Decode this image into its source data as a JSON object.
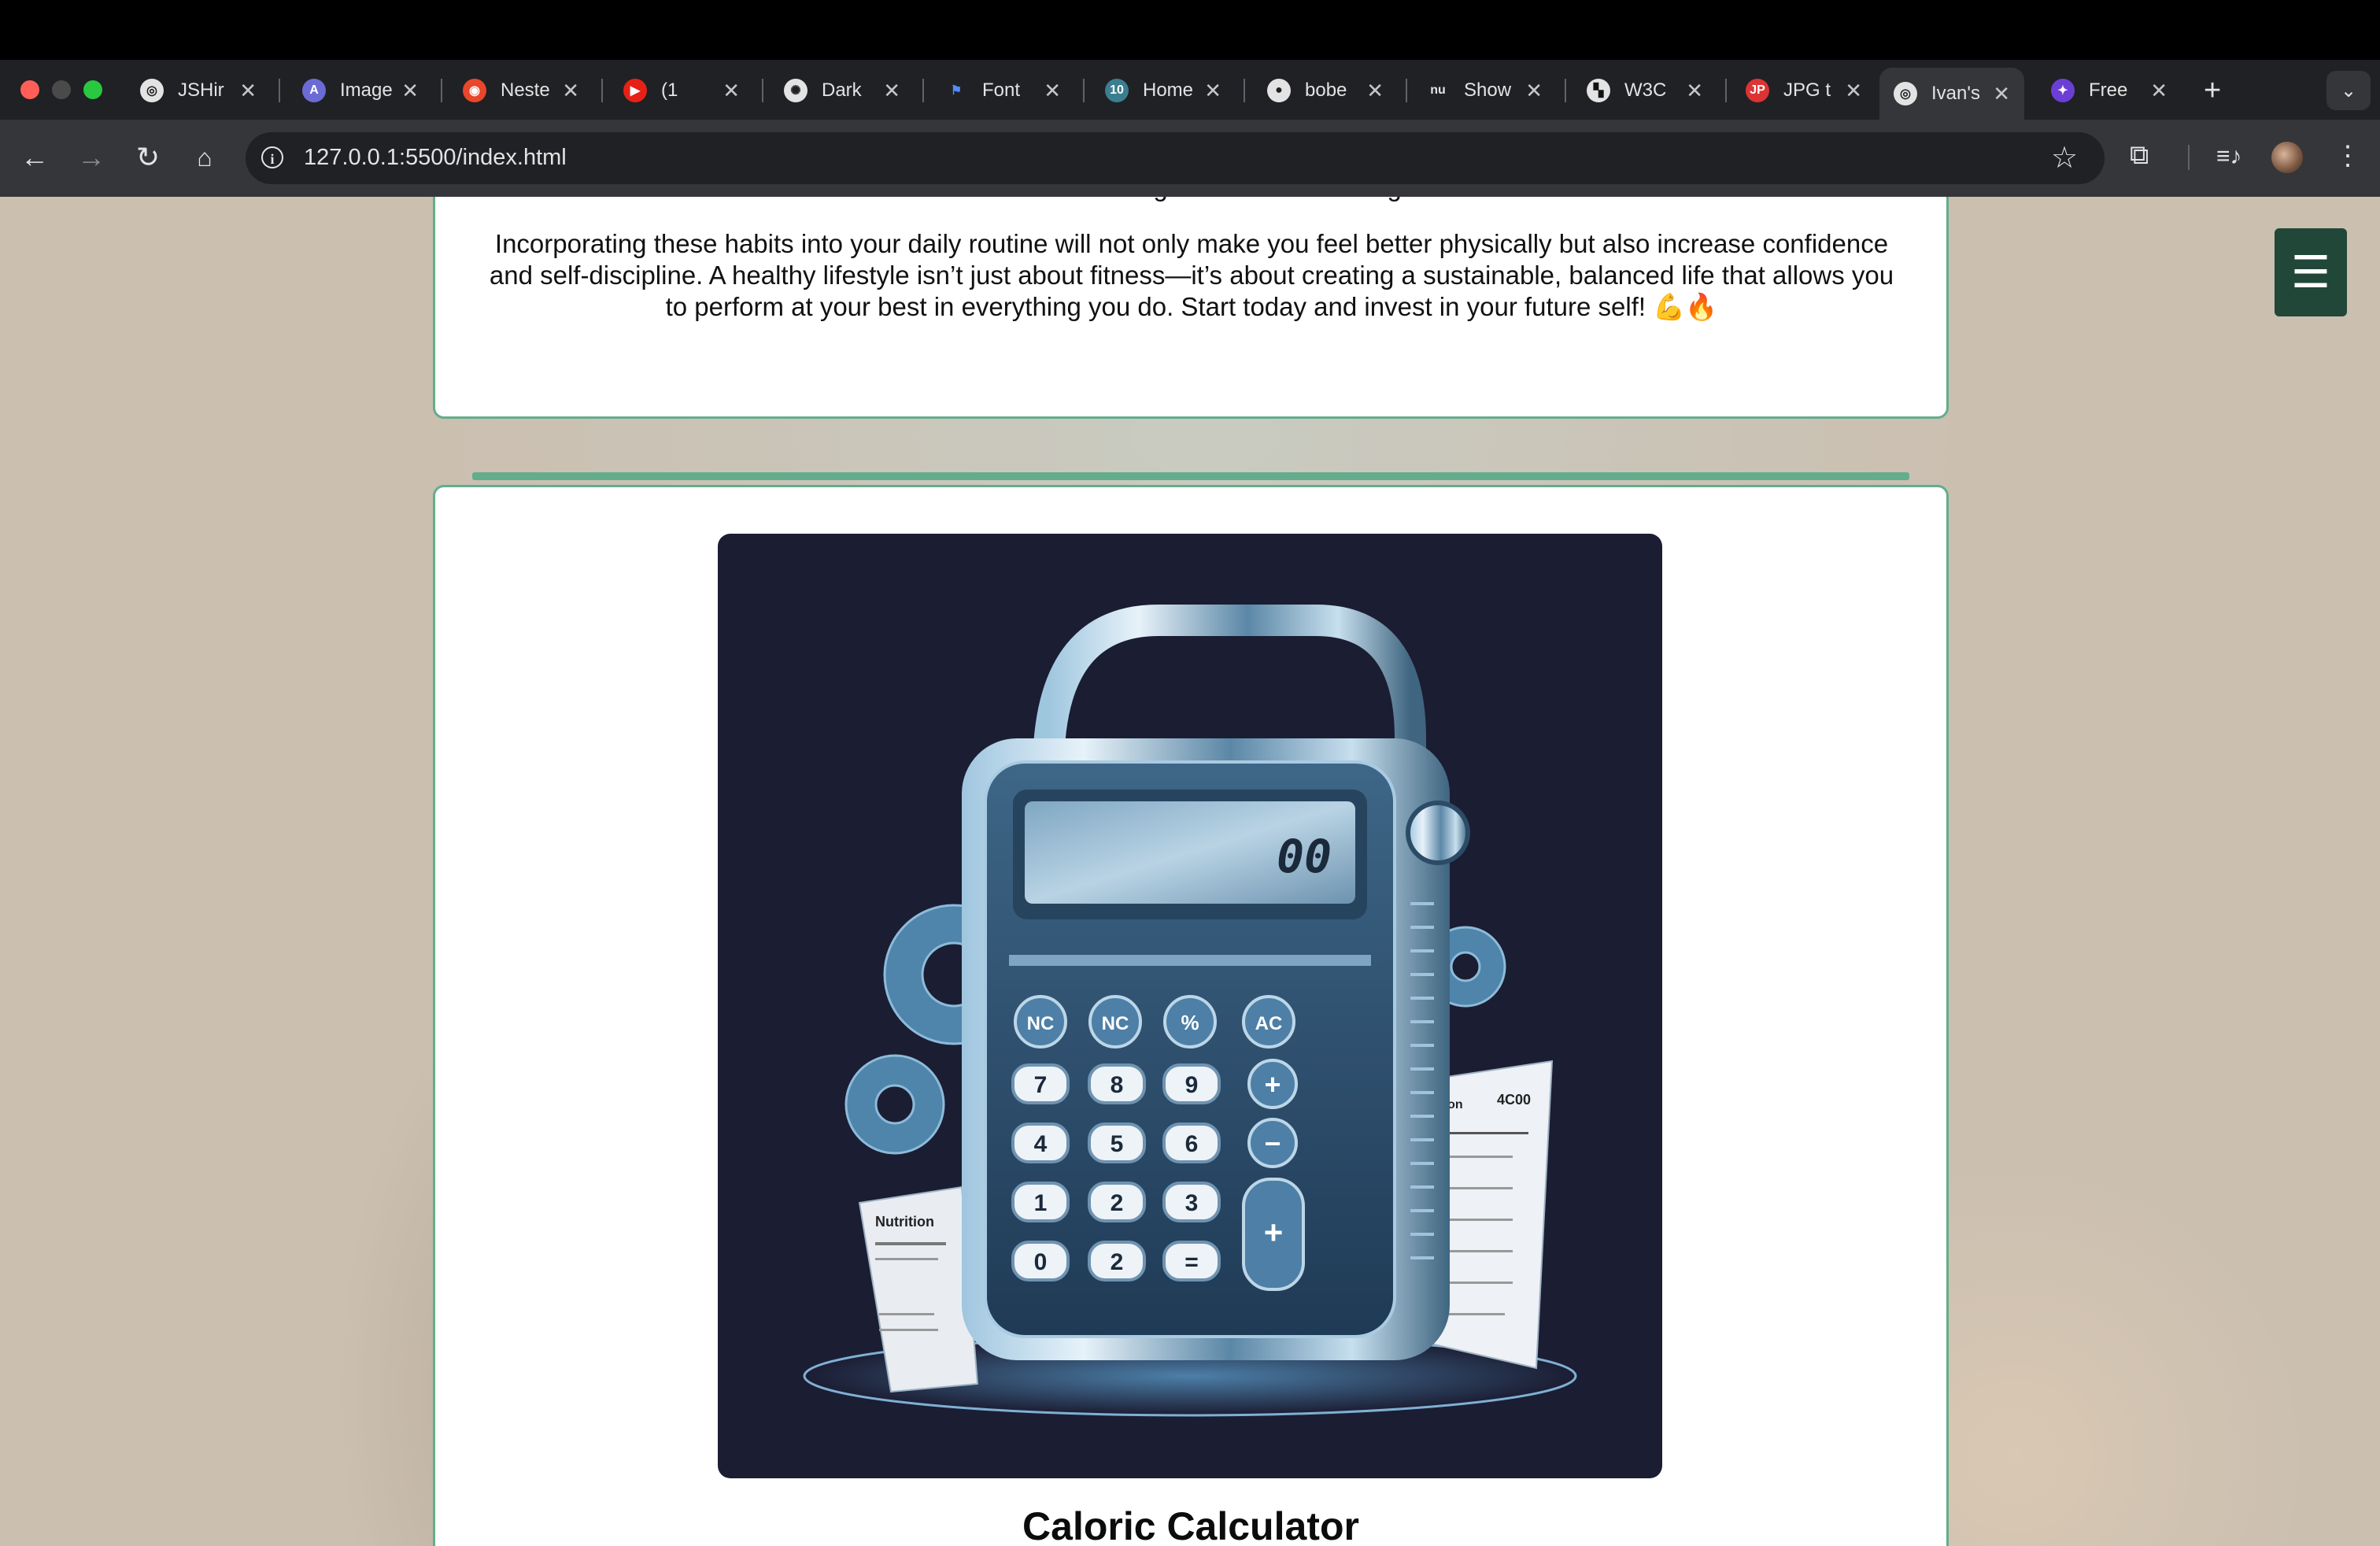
{
  "browser": {
    "tabs": [
      {
        "title": "JSHir",
        "icon": "globe-icon"
      },
      {
        "title": "Image",
        "icon": "ai-image-icon"
      },
      {
        "title": "Neste",
        "icon": "target-icon"
      },
      {
        "title": "(1",
        "icon": "youtube-icon"
      },
      {
        "title": "Dark",
        "icon": "openai-icon"
      },
      {
        "title": "Font",
        "icon": "flag-icon"
      },
      {
        "title": "Home",
        "icon": "w3schools-icon"
      },
      {
        "title": "bobe",
        "icon": "github-icon"
      },
      {
        "title": "Show",
        "icon": "nu-icon"
      },
      {
        "title": "W3C",
        "icon": "w3c-icon"
      },
      {
        "title": "JPG t",
        "icon": "jpg-png-icon"
      },
      {
        "title": "Ivan's",
        "icon": "globe-icon"
      },
      {
        "title": "Free",
        "icon": "sparkle-icon"
      }
    ],
    "new_tab_label": "+",
    "url": "127.0.0.1:5500/index.html"
  },
  "page": {
    "paragraph1_tail": "contributes to a longer and more fulfilling life.",
    "paragraph2": "Incorporating these habits into your daily routine will not only make you feel better physically but also increase confidence and self-discipline. A healthy lifestyle isn’t just about fitness—it’s about creating a sustainable, balanced life that allows you to perform at your best in everything you do. Start today and invest in your future self! 💪🔥",
    "calculator_title": "Caloric Calculator",
    "image": {
      "display_reading": "00",
      "left_receipt_title": "Nutrition",
      "right_receipt_label": "Nutrition",
      "right_receipt_value": "4C00",
      "keys_row1": [
        "NC",
        "NC",
        "%",
        "AC"
      ],
      "keys_row2": [
        "7",
        "8",
        "9",
        "+"
      ],
      "keys_row3": [
        "4",
        "5",
        "6",
        "−"
      ],
      "keys_row4": [
        "1",
        "2",
        "3",
        "+"
      ],
      "keys_row5": [
        "0",
        "2",
        "="
      ]
    },
    "menu_icon": "hamburger-icon"
  }
}
